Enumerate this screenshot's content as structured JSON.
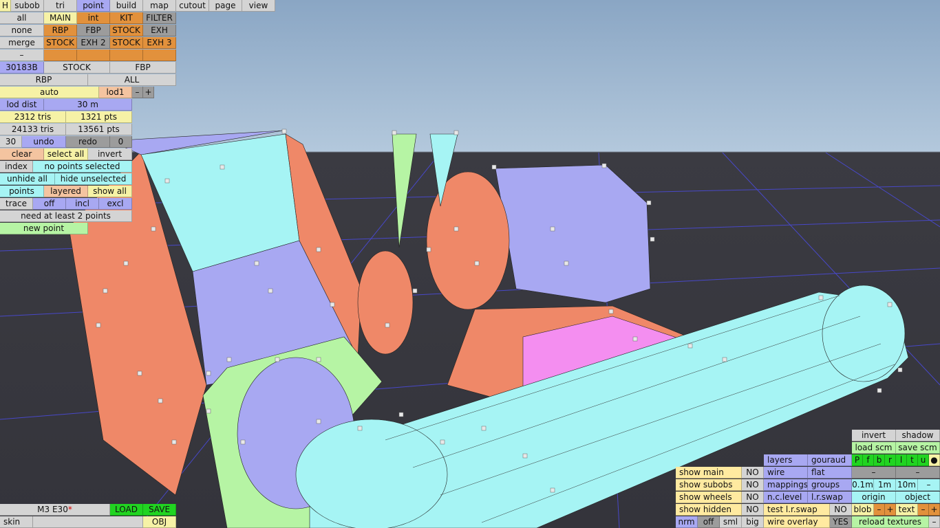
{
  "menu": {
    "h": "H",
    "items": [
      "subob",
      "tri",
      "point",
      "build",
      "map",
      "cutout",
      "page",
      "view"
    ]
  },
  "sel": {
    "all": "all",
    "none": "none",
    "merge": "merge",
    "dash": "–",
    "row1": [
      "MAIN",
      "int",
      "KIT",
      "FILTER"
    ],
    "row2": [
      "RBP",
      "FBP",
      "STOCK",
      "EXH"
    ],
    "row3": [
      "STOCK",
      "EXH 2",
      "STOCK",
      "EXH 3"
    ]
  },
  "subob": {
    "id": "30183B",
    "stock": "STOCK",
    "fbp": "FBP",
    "rbp": "RBP",
    "all": "ALL"
  },
  "lod": {
    "auto": "auto",
    "lod": "lod1",
    "minus": "–",
    "plus": "+",
    "dist_label": "lod dist",
    "dist_value": "30 m"
  },
  "stats": {
    "tris": "2312 tris",
    "pts": "1321 pts",
    "tris_total": "24133 tris",
    "pts_total": "13561 pts"
  },
  "history": {
    "count": "30",
    "undo": "undo",
    "redo": "redo",
    "zero": "0"
  },
  "points": {
    "clear": "clear",
    "select_all": "select all",
    "invert": "invert",
    "index": "index",
    "selected": "no points selected",
    "unhide": "unhide all",
    "hide_unsel": "hide unselected",
    "points": "points",
    "layered": "layered",
    "show_all": "show all",
    "trace": "trace",
    "off": "off",
    "incl": "incl",
    "excl": "excl",
    "need": "need at least 2 points",
    "new_point": "new point"
  },
  "file": {
    "name": "M3 E30",
    "mark": "*",
    "load": "LOAD",
    "save": "SAVE",
    "skin": "skin",
    "obj": "OBJ"
  },
  "right": {
    "invert": "invert",
    "shadow": "shadow",
    "load_scm": "load scm",
    "save_scm": "save scm",
    "flags": [
      "P",
      "f",
      "b",
      "r",
      "l",
      "t",
      "u",
      "●"
    ],
    "layers": "layers",
    "gouraud": "gouraud",
    "dash": "–",
    "show_main": "show main",
    "show_subobs": "show subobs",
    "show_wheels": "show wheels",
    "show_hidden": "show hidden",
    "no": "NO",
    "yes": "YES",
    "wire": "wire",
    "flat": "flat",
    "mappings": "mappings",
    "groups": "groups",
    "ncl": "n.c.level",
    "lrswap": "l.r.swap",
    "test_lrswap": "test l.r.swap",
    "wire_overlay": "wire overlay",
    "m01": "0.1m",
    "m1": "1m",
    "m10": "10m",
    "origin": "origin",
    "object": "object",
    "nrm": "nrm",
    "off": "off",
    "sml": "sml",
    "big": "big",
    "blob": "blob",
    "text": "text",
    "plus": "+",
    "reload": "reload textures"
  }
}
